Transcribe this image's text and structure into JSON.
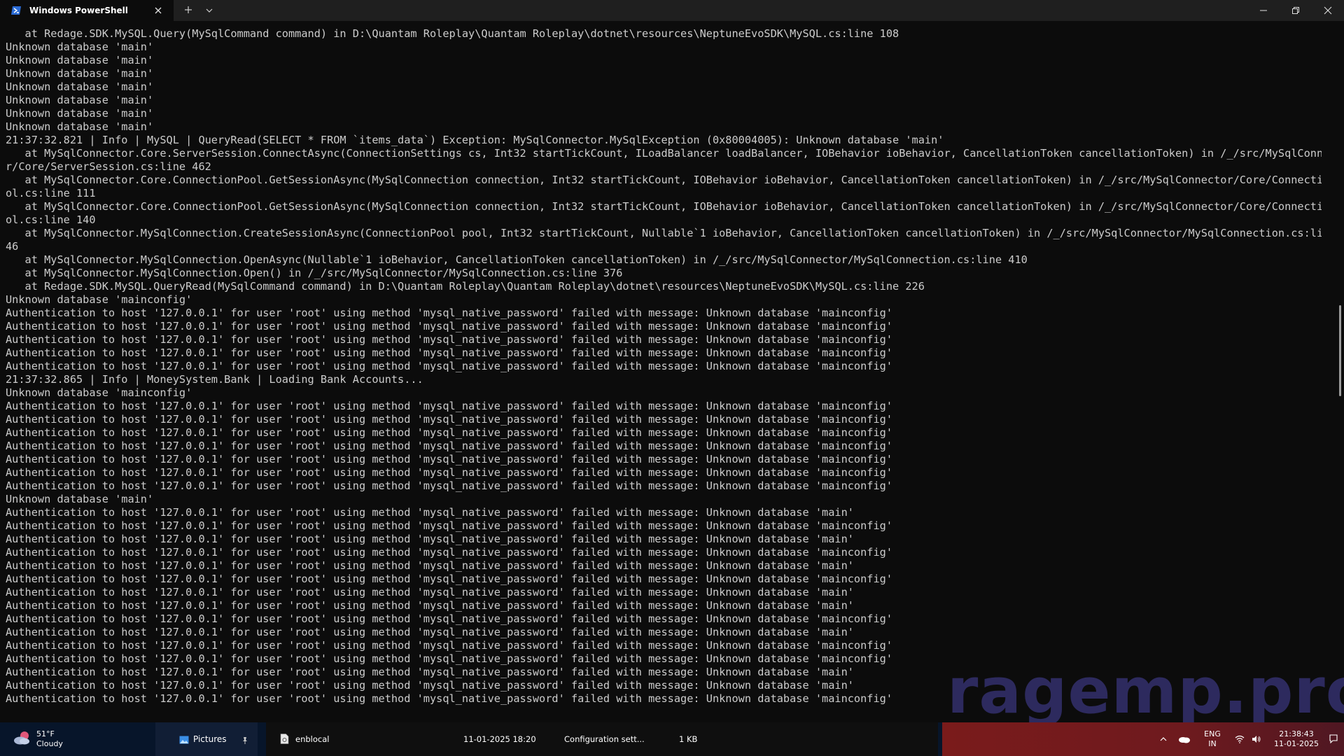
{
  "window": {
    "tab_title": "Windows PowerShell",
    "new_tab_icon": "plus-icon",
    "dropdown_icon": "chevron-down-icon",
    "tab_icon": "powershell-icon"
  },
  "terminal": {
    "lines": [
      "   at Redage.SDK.MySQL.Query(MySqlCommand command) in D:\\Quantam Roleplay\\Quantam Roleplay\\dotnet\\resources\\NeptuneEvoSDK\\MySQL.cs:line 108",
      "Unknown database 'main'",
      "Unknown database 'main'",
      "Unknown database 'main'",
      "Unknown database 'main'",
      "Unknown database 'main'",
      "Unknown database 'main'",
      "Unknown database 'main'",
      "21:37:32.821 | Info | MySQL | QueryRead(SELECT * FROM `items_data`) Exception: MySqlConnector.MySqlException (0x80004005): Unknown database 'main'",
      "   at MySqlConnector.Core.ServerSession.ConnectAsync(ConnectionSettings cs, Int32 startTickCount, ILoadBalancer loadBalancer, IOBehavior ioBehavior, CancellationToken cancellationToken) in /_/src/MySqlConnecto",
      "r/Core/ServerSession.cs:line 462",
      "   at MySqlConnector.Core.ConnectionPool.GetSessionAsync(MySqlConnection connection, Int32 startTickCount, IOBehavior ioBehavior, CancellationToken cancellationToken) in /_/src/MySqlConnector/Core/ConnectionPo",
      "ol.cs:line 111",
      "   at MySqlConnector.Core.ConnectionPool.GetSessionAsync(MySqlConnection connection, Int32 startTickCount, IOBehavior ioBehavior, CancellationToken cancellationToken) in /_/src/MySqlConnector/Core/ConnectionPo",
      "ol.cs:line 140",
      "   at MySqlConnector.MySqlConnection.CreateSessionAsync(ConnectionPool pool, Int32 startTickCount, Nullable`1 ioBehavior, CancellationToken cancellationToken) in /_/src/MySqlConnector/MySqlConnection.cs:line 8",
      "46",
      "   at MySqlConnector.MySqlConnection.OpenAsync(Nullable`1 ioBehavior, CancellationToken cancellationToken) in /_/src/MySqlConnector/MySqlConnection.cs:line 410",
      "   at MySqlConnector.MySqlConnection.Open() in /_/src/MySqlConnector/MySqlConnection.cs:line 376",
      "   at Redage.SDK.MySQL.QueryRead(MySqlCommand command) in D:\\Quantam Roleplay\\Quantam Roleplay\\dotnet\\resources\\NeptuneEvoSDK\\MySQL.cs:line 226",
      "Unknown database 'mainconfig'",
      "Authentication to host '127.0.0.1' for user 'root' using method 'mysql_native_password' failed with message: Unknown database 'mainconfig'",
      "Authentication to host '127.0.0.1' for user 'root' using method 'mysql_native_password' failed with message: Unknown database 'mainconfig'",
      "Authentication to host '127.0.0.1' for user 'root' using method 'mysql_native_password' failed with message: Unknown database 'mainconfig'",
      "Authentication to host '127.0.0.1' for user 'root' using method 'mysql_native_password' failed with message: Unknown database 'mainconfig'",
      "Authentication to host '127.0.0.1' for user 'root' using method 'mysql_native_password' failed with message: Unknown database 'mainconfig'",
      "21:37:32.865 | Info | MoneySystem.Bank | Loading Bank Accounts...",
      "Unknown database 'mainconfig'",
      "Authentication to host '127.0.0.1' for user 'root' using method 'mysql_native_password' failed with message: Unknown database 'mainconfig'",
      "Authentication to host '127.0.0.1' for user 'root' using method 'mysql_native_password' failed with message: Unknown database 'mainconfig'",
      "Authentication to host '127.0.0.1' for user 'root' using method 'mysql_native_password' failed with message: Unknown database 'mainconfig'",
      "Authentication to host '127.0.0.1' for user 'root' using method 'mysql_native_password' failed with message: Unknown database 'mainconfig'",
      "Authentication to host '127.0.0.1' for user 'root' using method 'mysql_native_password' failed with message: Unknown database 'mainconfig'",
      "Authentication to host '127.0.0.1' for user 'root' using method 'mysql_native_password' failed with message: Unknown database 'mainconfig'",
      "Authentication to host '127.0.0.1' for user 'root' using method 'mysql_native_password' failed with message: Unknown database 'mainconfig'",
      "Unknown database 'main'",
      "Authentication to host '127.0.0.1' for user 'root' using method 'mysql_native_password' failed with message: Unknown database 'main'",
      "Authentication to host '127.0.0.1' for user 'root' using method 'mysql_native_password' failed with message: Unknown database 'mainconfig'",
      "Authentication to host '127.0.0.1' for user 'root' using method 'mysql_native_password' failed with message: Unknown database 'main'",
      "Authentication to host '127.0.0.1' for user 'root' using method 'mysql_native_password' failed with message: Unknown database 'mainconfig'",
      "Authentication to host '127.0.0.1' for user 'root' using method 'mysql_native_password' failed with message: Unknown database 'main'",
      "Authentication to host '127.0.0.1' for user 'root' using method 'mysql_native_password' failed with message: Unknown database 'mainconfig'",
      "Authentication to host '127.0.0.1' for user 'root' using method 'mysql_native_password' failed with message: Unknown database 'main'",
      "Authentication to host '127.0.0.1' for user 'root' using method 'mysql_native_password' failed with message: Unknown database 'main'",
      "Authentication to host '127.0.0.1' for user 'root' using method 'mysql_native_password' failed with message: Unknown database 'mainconfig'",
      "Authentication to host '127.0.0.1' for user 'root' using method 'mysql_native_password' failed with message: Unknown database 'main'",
      "Authentication to host '127.0.0.1' for user 'root' using method 'mysql_native_password' failed with message: Unknown database 'mainconfig'",
      "Authentication to host '127.0.0.1' for user 'root' using method 'mysql_native_password' failed with message: Unknown database 'mainconfig'",
      "Authentication to host '127.0.0.1' for user 'root' using method 'mysql_native_password' failed with message: Unknown database 'main'",
      "Authentication to host '127.0.0.1' for user 'root' using method 'mysql_native_password' failed with message: Unknown database 'main'",
      "Authentication to host '127.0.0.1' for user 'root' using method 'mysql_native_password' failed with message: Unknown database 'mainconfig'"
    ]
  },
  "watermark": {
    "text": "ragemp.pro",
    "color": "#2d2a5e"
  },
  "taskbar": {
    "weather": {
      "temp": "51°F",
      "desc": "Cloudy",
      "icon": "cloudy-weather-icon"
    },
    "pictures": {
      "label": "Pictures",
      "icon": "pictures-folder-icon",
      "pin_icon": "pin-icon"
    },
    "file": {
      "name": "enblocal",
      "date": "11-01-2025 18:20",
      "type": "Configuration sett...",
      "size": "1 KB",
      "icon": "config-file-icon"
    },
    "tray": {
      "chevron_icon": "chevron-up-icon",
      "cloud_icon": "onedrive-cloud-icon",
      "lang_top": "ENG",
      "lang_bottom": "IN",
      "wifi_icon": "wifi-icon",
      "volume_icon": "volume-icon",
      "time": "21:38:43",
      "date": "11-01-2025",
      "notification_icon": "notification-icon"
    }
  }
}
